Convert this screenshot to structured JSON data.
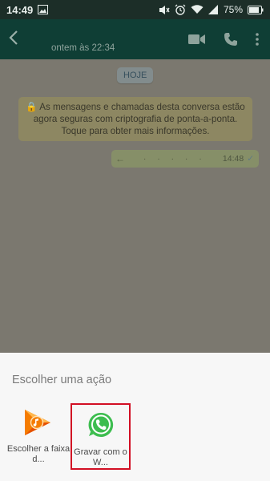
{
  "status_bar": {
    "time": "14:49",
    "battery": "75%",
    "icons": [
      "image-icon",
      "mute-icon",
      "alarm-icon",
      "wifi-icon",
      "signal-icon",
      "battery-icon"
    ]
  },
  "app_bar": {
    "last_seen": "ontem às 22:34",
    "icons": [
      "back-icon",
      "video-call-icon",
      "phone-icon",
      "more-icon"
    ]
  },
  "chat": {
    "date_label": "HOJE",
    "encryption_notice": "🔒 As mensagens e chamadas desta conversa estão agora seguras com criptografia de ponta-a-ponta. Toque para obter mais informações.",
    "message": {
      "time": "14:48",
      "status": "✓"
    }
  },
  "sheet": {
    "title": "Escolher uma ação",
    "options": [
      {
        "label": "Escolher a faixa d...",
        "icon": "google-play-music-icon"
      },
      {
        "label": "Gravar com o W...",
        "icon": "whatsapp-icon"
      }
    ]
  },
  "colors": {
    "app_bar": "#0f3e35",
    "highlight_border": "#d20f24",
    "whatsapp_green": "#3dbd4f"
  }
}
